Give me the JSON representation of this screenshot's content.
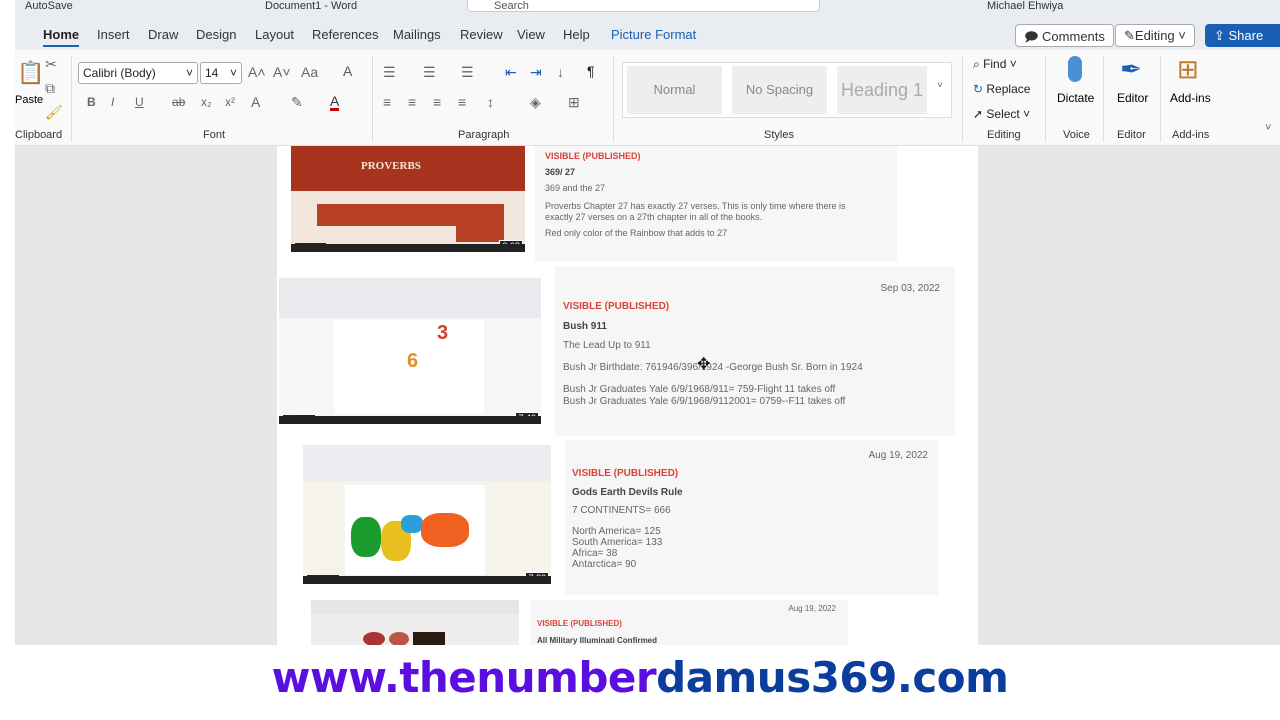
{
  "titlebar": {
    "autosave": "AutoSave",
    "autosave_state": "Off",
    "doc_title": "Document1 - Word",
    "search_placeholder": "Search",
    "user": "Michael Ehwiya"
  },
  "tabs": [
    "Home",
    "Insert",
    "Draw",
    "Design",
    "Layout",
    "References",
    "Mailings",
    "Review",
    "View",
    "Help",
    "Picture Format"
  ],
  "top_buttons": {
    "comments": "Comments",
    "editing": "Editing",
    "share": "Share"
  },
  "ribbon": {
    "clipboard": {
      "paste": "Paste",
      "label": "Clipboard"
    },
    "font": {
      "name": "Calibri (Body)",
      "size": "14",
      "label": "Font"
    },
    "paragraph": {
      "label": "Paragraph"
    },
    "styles": {
      "items": [
        "Normal",
        "No Spacing",
        "Heading 1"
      ],
      "label": "Styles"
    },
    "editing": {
      "find": "Find",
      "replace": "Replace",
      "select": "Select",
      "label": "Editing"
    },
    "voice": {
      "dictate": "Dictate",
      "label": "Voice"
    },
    "editor": {
      "button": "Editor",
      "label": "Editor"
    },
    "addins": {
      "button": "Add-ins",
      "label": "Add-ins"
    }
  },
  "entries": [
    {
      "status": "VISIBLE (PUBLISHED)",
      "title": "369/ 27",
      "subtitle": "369 and the 27",
      "lines": [
        "Proverbs Chapter 27 has exactly 27 verses. This is only time where there is exactly 27 verses on a 27th chapter in all of the books.",
        "Red only color of the Rainbow that adds to 27"
      ],
      "views": "117",
      "duration": "3:08",
      "thumb_text": "PROVERBS"
    },
    {
      "date": "Sep 03, 2022",
      "status": "VISIBLE (PUBLISHED)",
      "title": "Bush 911",
      "subtitle": "The Lead Up to 911",
      "lines": [
        "Bush Jr Birthdate: 761946/396/1924 -George Bush Sr. Born in 1924",
        "Bush Jr Graduates Yale 6/9/1968/911= 759-Flight 11 takes off",
        "Bush Jr Graduates Yale 6/9/1968/9112001= 0759--F11 takes off"
      ],
      "views": "151",
      "duration": "7:49",
      "thumb_digits": [
        "3",
        "6"
      ]
    },
    {
      "date": "Aug 19, 2022",
      "status": "VISIBLE (PUBLISHED)",
      "title": "Gods Earth Devils Rule",
      "subtitle": "7 CONTINENTS= 666",
      "lines": [
        "North America= 125",
        "South America= 133",
        "Africa= 38",
        "Antarctica= 90"
      ],
      "views": "315",
      "duration": "7:32"
    },
    {
      "date": "Aug 19, 2022",
      "status": "VISIBLE (PUBLISHED)",
      "title": "All Military Illuminati Confirmed"
    }
  ],
  "banner": {
    "part1": "www.thenumber",
    "part2": "damus369.com",
    "color1": "#5b0ee0",
    "color2": "#0a3d9c"
  }
}
